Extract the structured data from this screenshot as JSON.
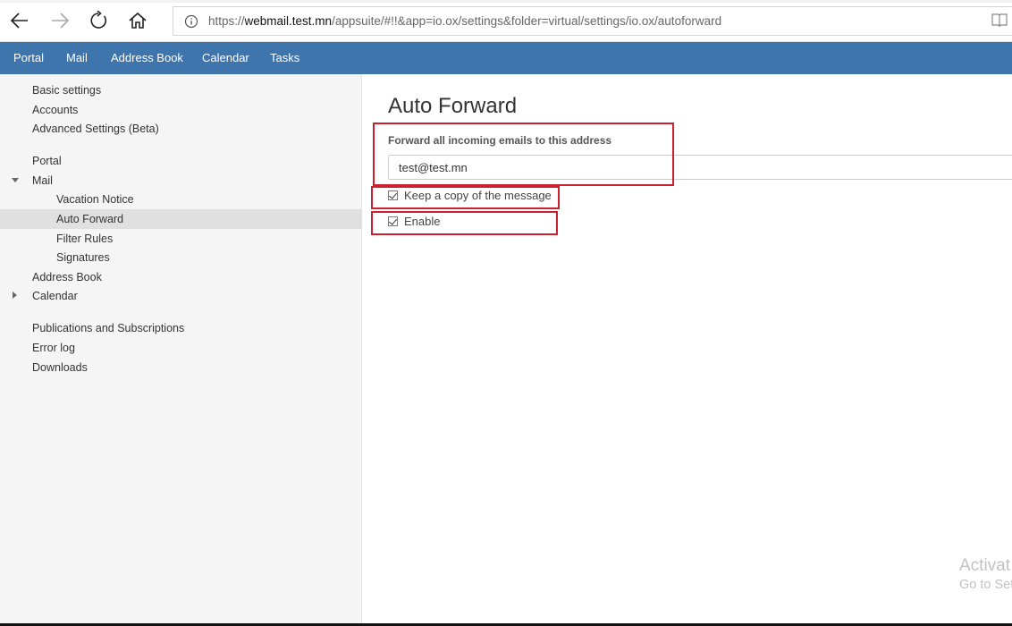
{
  "browser": {
    "url_scheme": "https://",
    "url_host": "webmail.test.mn",
    "url_path": "/appsuite/#!!&app=io.ox/settings&folder=virtual/settings/io.ox/autoforward"
  },
  "appbar": {
    "items": [
      "Portal",
      "Mail",
      "Address Book",
      "Calendar",
      "Tasks"
    ]
  },
  "sidebar": {
    "basic_settings": "Basic settings",
    "accounts": "Accounts",
    "advanced_settings": "Advanced Settings (Beta)",
    "portal": "Portal",
    "mail": "Mail",
    "vacation_notice": "Vacation Notice",
    "auto_forward": "Auto Forward",
    "filter_rules": "Filter Rules",
    "signatures": "Signatures",
    "address_book": "Address Book",
    "calendar": "Calendar",
    "publications": "Publications and Subscriptions",
    "error_log": "Error log",
    "downloads": "Downloads"
  },
  "main": {
    "title": "Auto Forward",
    "forward_label": "Forward all incoming emails to this address",
    "forward_value": "test@test.mn",
    "keep_copy_label": "Keep a copy of the message",
    "keep_copy_checked": true,
    "enable_label": "Enable",
    "enable_checked": true
  },
  "watermark": {
    "line1": "Activat",
    "line2": "Go to Set"
  },
  "colors": {
    "appbar": "#3f75ad",
    "highlight_border": "#cc1f2f",
    "sidebar_bg": "#f5f5f5",
    "selected_item_bg": "#e0e0e0"
  },
  "icons": [
    "back-arrow-icon",
    "forward-arrow-icon",
    "refresh-icon",
    "home-icon",
    "info-icon",
    "reading-view-icon"
  ]
}
